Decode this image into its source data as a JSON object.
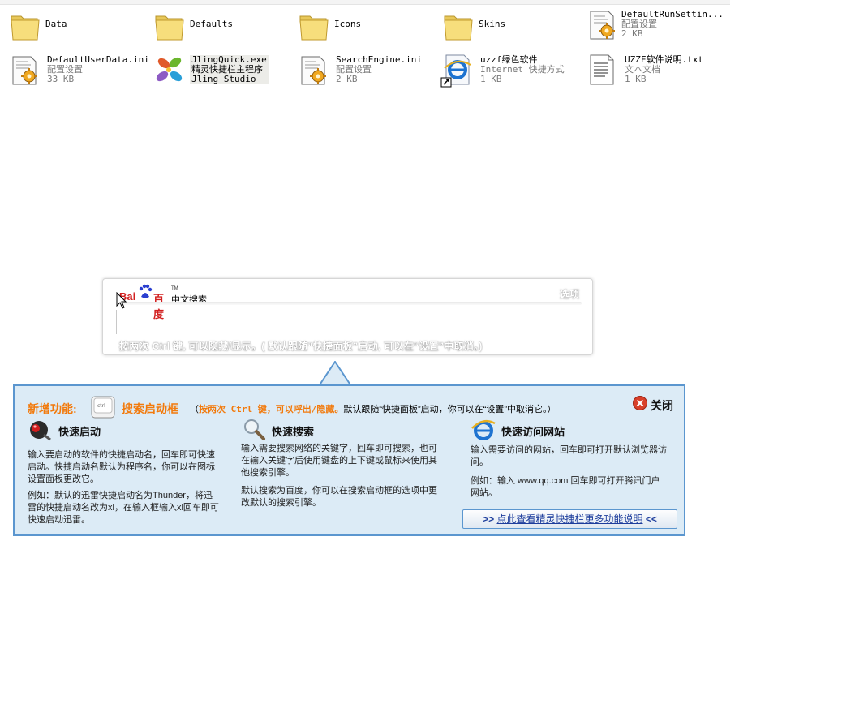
{
  "files": [
    {
      "l1": "Data",
      "type": "folder"
    },
    {
      "l1": "Defaults",
      "type": "folder"
    },
    {
      "l1": "Icons",
      "type": "folder"
    },
    {
      "l1": "Skins",
      "type": "folder"
    },
    {
      "l1": "DefaultRunSettin...",
      "l2": "配置设置",
      "l3": "2 KB",
      "type": "config"
    },
    {
      "l1": "DefaultUserData.ini",
      "l2": "配置设置",
      "l3": "33 KB",
      "type": "config"
    },
    {
      "l1": "JlingQuick.exe",
      "l2": "精灵快捷栏主程序",
      "l3": "Jling Studio",
      "type": "exe"
    },
    {
      "l1": "SearchEngine.ini",
      "l2": "配置设置",
      "l3": "2 KB",
      "type": "config"
    },
    {
      "l1": "uzzf绿色软件",
      "l2": "Internet 快捷方式",
      "l3": "1 KB",
      "type": "ie"
    },
    {
      "l1": "UZZF软件说明.txt",
      "l2": "文本文档",
      "l3": "1 KB",
      "type": "txt"
    }
  ],
  "search": {
    "logo_bai": "Bai",
    "logo_du": "百度",
    "logo_tm": "TM",
    "logo_cn": "中文搜索",
    "options": "选项",
    "value": "",
    "hint": "按两次 Ctrl 键, 可以隐藏/显示。( 默认跟随“快捷面板”启动, 可以在“设置”中取消。)"
  },
  "panel": {
    "new_label": "新增功能:",
    "feature_name": "搜索启动框",
    "tip_open": "（",
    "tip_hi": "按两次 Ctrl 键，可以呼出/隐藏。",
    "tip_rest": "默认跟随“快捷面板”启动，你可以在“设置”中取消它。）",
    "close": "关闭",
    "col1": {
      "title": "快速启动",
      "p1": "输入要启动的软件的快捷启动名，回车即可快速启动。快捷启动名默认为程序名，你可以在图标设置面板更改它。",
      "p2": "例如：默认的迅雷快捷启动名为Thunder，将迅雷的快捷启动名改为xl，在输入框输入xl回车即可快速启动迅雷。"
    },
    "col2": {
      "title": "快速搜索",
      "p1": "输入需要搜索网络的关键字，回车即可搜索，也可在输入关键字后使用键盘的上下键或鼠标来使用其他搜索引擎。",
      "p2": "默认搜索为百度，你可以在搜索启动框的选项中更改默认的搜索引擎。"
    },
    "col3": {
      "title": "快速访问网站",
      "p1": "输入需要访问的网站，回车即可打开默认浏览器访问。",
      "p2": "例如：输入 www.qq.com 回车即可打开腾讯门户网站。"
    },
    "more_left": ">>",
    "more_link": "点此查看精灵快捷栏更多功能说明",
    "more_right": "<<"
  },
  "colors": {
    "accent_orange": "#f27a0c",
    "panel_bg": "#dcebf6",
    "panel_border": "#5b96cf",
    "link": "#1d3d9c"
  }
}
